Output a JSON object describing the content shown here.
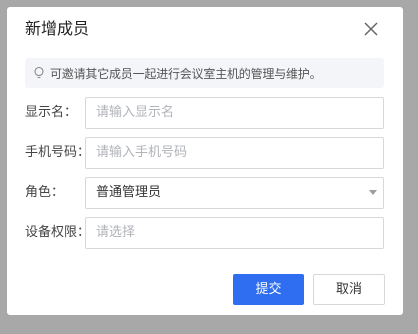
{
  "dialog": {
    "title": "新增成员",
    "close_icon": "close-icon",
    "tip": {
      "icon": "lightbulb-icon",
      "text": "可邀请其它成员一起进行会议室主机的管理与维护。"
    },
    "fields": [
      {
        "label": "显示名：",
        "placeholder": "请输入显示名",
        "value": ""
      },
      {
        "label": "手机号码：",
        "placeholder": "请输入手机号码",
        "value": ""
      },
      {
        "label": "角色：",
        "value": "普通管理员"
      },
      {
        "label": "设备权限：",
        "placeholder": "请选择",
        "value": ""
      }
    ],
    "buttons": {
      "submit": "提交",
      "cancel": "取消"
    }
  },
  "colors": {
    "primary": "#2f6ef0",
    "overlay": "#a8a8a8",
    "tip_bg": "#f3f5f9"
  }
}
